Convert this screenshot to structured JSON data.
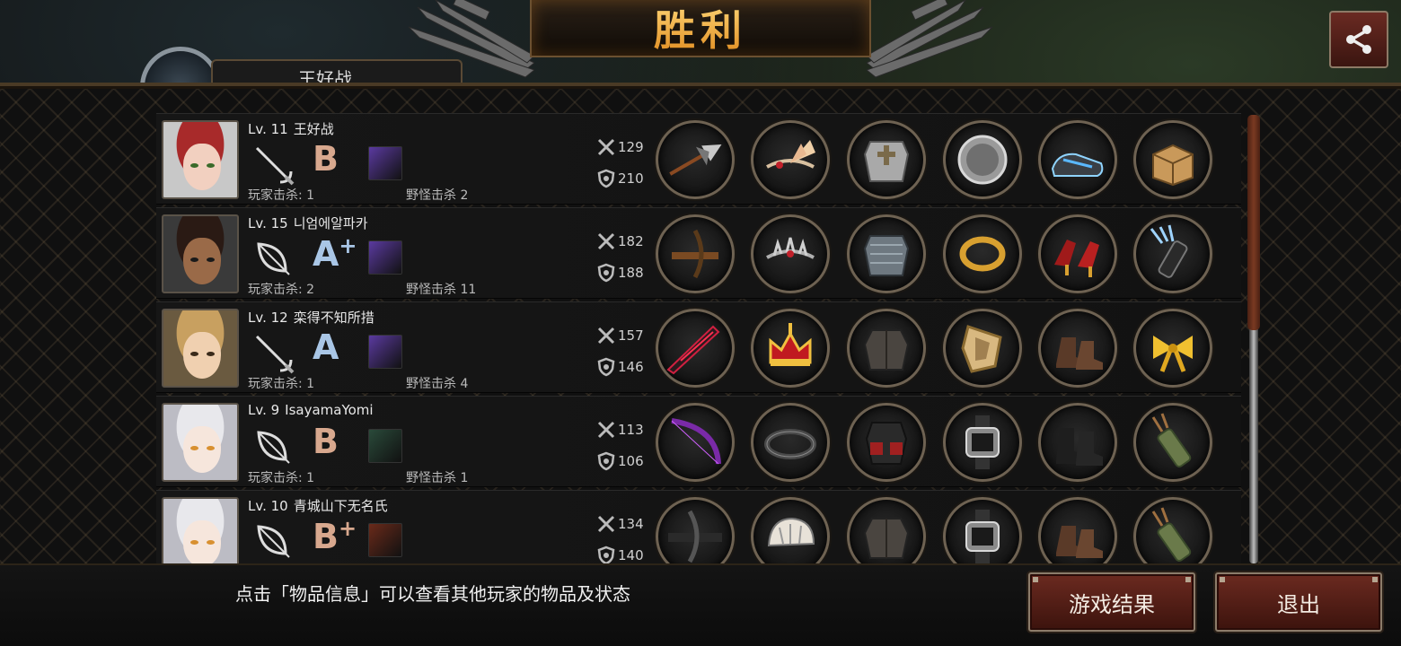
{
  "header": {
    "title": "胜利",
    "top_tab_label": "王好战"
  },
  "share": {
    "icon": "share-icon"
  },
  "stat_labels": {
    "player_kills": "玩家击杀",
    "monster_kills": "野怪击杀"
  },
  "players": [
    {
      "level": "Lv. 11",
      "name": "王好战",
      "weapon": "rapier",
      "grade": "B",
      "grade_plus": "",
      "player_kills_text": "玩家击杀: 1",
      "monster_kills_text": "野怪击杀 2",
      "attack": "129",
      "defense": "210",
      "items": [
        "spear-weapon",
        "winged-tiara",
        "plate-armor",
        "metal-shield-disc",
        "sneakers",
        "supply-box"
      ]
    },
    {
      "level": "Lv. 15",
      "name": "니엄에알파카",
      "weapon": "bow",
      "grade": "A",
      "grade_plus": "+",
      "player_kills_text": "玩家击杀: 2",
      "monster_kills_text": "野怪击杀 11",
      "attack": "182",
      "defense": "188",
      "items": [
        "crossbow",
        "spiked-circlet",
        "chainmail",
        "gold-bracelet",
        "red-heels",
        "quiver"
      ]
    },
    {
      "level": "Lv. 12",
      "name": "栾得不知所措",
      "weapon": "rapier",
      "grade": "A",
      "grade_plus": "",
      "player_kills_text": "玩家击杀: 1",
      "monster_kills_text": "野怪击杀 4",
      "attack": "157",
      "defense": "146",
      "items": [
        "dark-blade",
        "royal-crown",
        "leather-jacket",
        "golden-shield",
        "leather-boots",
        "gold-ribbon"
      ]
    },
    {
      "level": "Lv. 9",
      "name": "IsayamaYomi",
      "weapon": "bow",
      "grade": "B",
      "grade_plus": "",
      "player_kills_text": "玩家击杀: 1",
      "monster_kills_text": "野怪击杀 1",
      "attack": "113",
      "defense": "106",
      "items": [
        "purple-bow",
        "headband",
        "tactical-vest",
        "sport-watch",
        "combat-boots",
        "arrow-quiver"
      ]
    },
    {
      "level": "Lv. 10",
      "name": "青城山下无名氏",
      "weapon": "bow",
      "grade": "B",
      "grade_plus": "+",
      "player_kills_text": "",
      "monster_kills_text": "",
      "attack": "134",
      "defense": "140",
      "items": [
        "heavy-crossbow",
        "bike-helmet",
        "leather-jacket",
        "sport-watch",
        "leather-boots",
        "arrow-quiver"
      ]
    }
  ],
  "footer": {
    "hint": "点击「物品信息」可以查看其他玩家的物品及状态",
    "results_button": "游戏结果",
    "exit_button": "退出"
  },
  "colors": {
    "accent_gold": "#f0a030",
    "button_red": "#6b2a20",
    "grade_b": "#d8a88e",
    "grade_a": "#a9c6e6"
  }
}
